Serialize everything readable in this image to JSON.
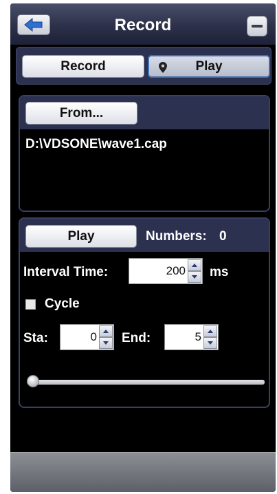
{
  "window": {
    "title": "Record"
  },
  "mode_tabs": {
    "record_label": "Record",
    "play_label": "Play",
    "selected": "Play"
  },
  "source": {
    "from_button_label": "From...",
    "file_path": "D:\\VDSONE\\wave1.cap"
  },
  "playback": {
    "play_button_label": "Play",
    "numbers_label": "Numbers:",
    "numbers_value": "0",
    "interval_label": "Interval Time:",
    "interval_value": "200",
    "interval_unit": "ms",
    "cycle_label": "Cycle",
    "cycle_checked": false,
    "start_label": "Sta:",
    "start_value": "0",
    "end_label": "End:",
    "end_value": "5",
    "slider_position": 0
  },
  "icons": {
    "back": "back-arrow-icon",
    "minimize": "minimize-icon",
    "pin": "map-pin-icon"
  },
  "colors": {
    "title_bar": "#2c3049",
    "panel_header": "#2c3150",
    "panel_border": "#3a4062",
    "selection_border": "#3f6fb0",
    "background": "#000000"
  }
}
